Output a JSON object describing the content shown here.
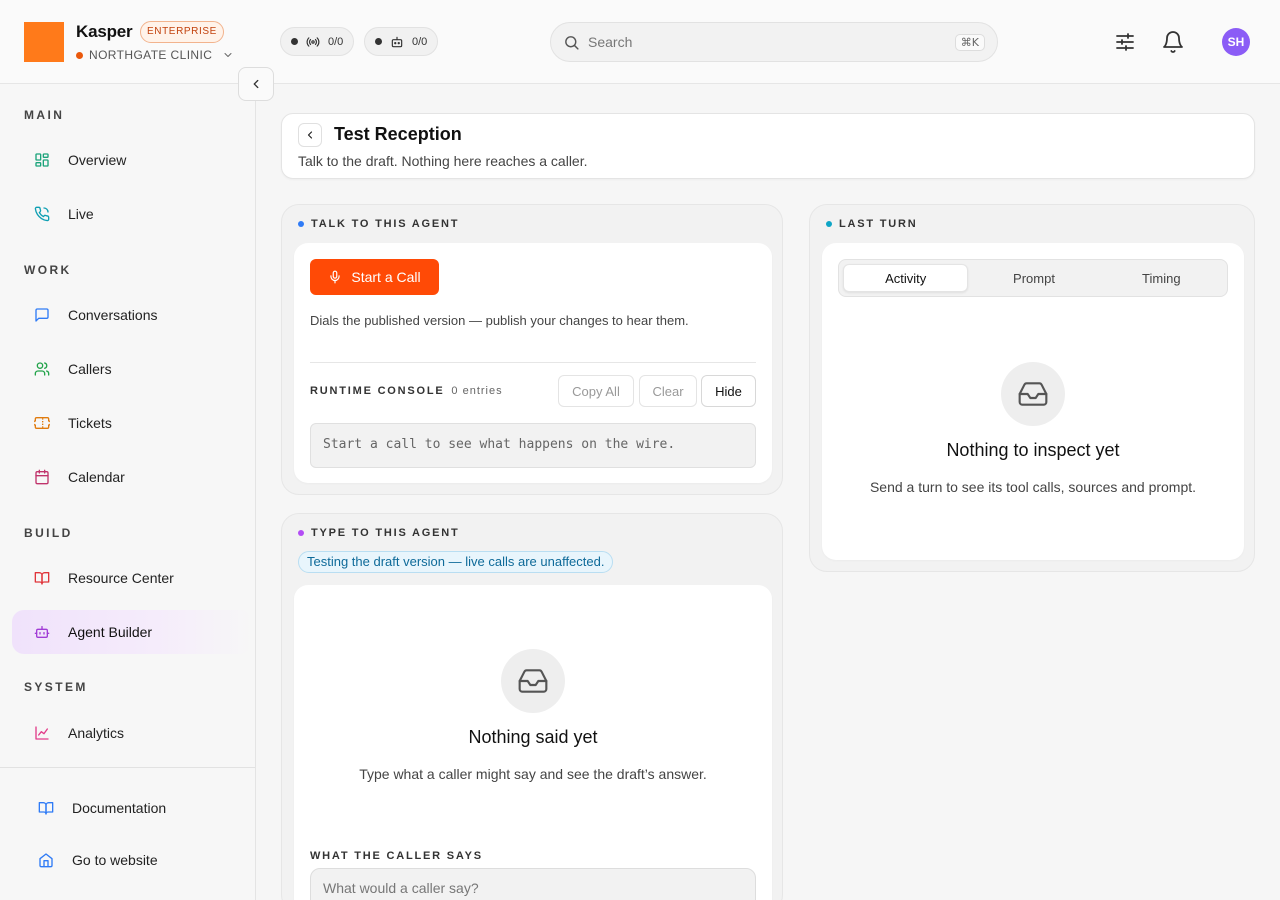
{
  "app": {
    "name": "Kasper",
    "plan_badge": "ENTERPRISE",
    "org": "NORTHGATE CLINIC"
  },
  "header": {
    "voice_pill": "0/0",
    "bot_pill": "0/0",
    "search_placeholder": "Search",
    "search_shortcut": "⌘K",
    "avatar_initials": "SH"
  },
  "sidebar": {
    "main_label": "MAIN",
    "work_label": "WORK",
    "build_label": "BUILD",
    "system_label": "SYSTEM",
    "items": [
      {
        "label": "Overview",
        "icon": "dashboard-icon"
      },
      {
        "label": "Live",
        "icon": "phone-icon"
      },
      {
        "label": "Conversations",
        "icon": "chat-icon"
      },
      {
        "label": "Callers",
        "icon": "users-icon"
      },
      {
        "label": "Tickets",
        "icon": "ticket-icon"
      },
      {
        "label": "Calendar",
        "icon": "calendar-icon"
      },
      {
        "label": "Resource Center",
        "icon": "book-icon"
      },
      {
        "label": "Agent Builder",
        "icon": "bot-icon",
        "active": true
      },
      {
        "label": "Analytics",
        "icon": "chart-icon"
      }
    ],
    "footer": [
      {
        "label": "Documentation",
        "icon": "book-open-icon"
      },
      {
        "label": "Go to website",
        "icon": "home-icon"
      }
    ]
  },
  "page": {
    "title": "Test Reception",
    "subtitle": "Talk to the draft. Nothing here reaches a caller."
  },
  "talk_panel": {
    "label": "TALK TO THIS AGENT",
    "start_call": "Start a Call",
    "note": "Dials the published version — publish your changes to hear them.",
    "console_label": "RUNTIME CONSOLE",
    "console_count": "0 entries",
    "copy_all": "Copy All",
    "clear": "Clear",
    "hide": "Hide",
    "console_placeholder": "Start a call to see what happens on the wire."
  },
  "type_panel": {
    "label": "TYPE TO THIS AGENT",
    "draft_badge": "Testing the draft version — live calls are unaffected.",
    "empty_title": "Nothing said yet",
    "empty_sub": "Type what a caller might say and see the draft’s answer.",
    "caller_label": "WHAT THE CALLER SAYS",
    "caller_placeholder": "What would a caller say?"
  },
  "last_turn": {
    "label": "LAST TURN",
    "tabs": [
      "Activity",
      "Prompt",
      "Timing"
    ],
    "active_tab": "Activity",
    "empty_title": "Nothing to inspect yet",
    "empty_sub": "Send a turn to see its tool calls, sources and prompt."
  },
  "colors": {
    "brand": "#ff7a1a",
    "call_button": "#ff4a06",
    "talk_dot": "#2f7bf6",
    "type_dot": "#b34df5",
    "turn_dot": "#0ea5c6",
    "active_nav": "#f0e2fb"
  }
}
